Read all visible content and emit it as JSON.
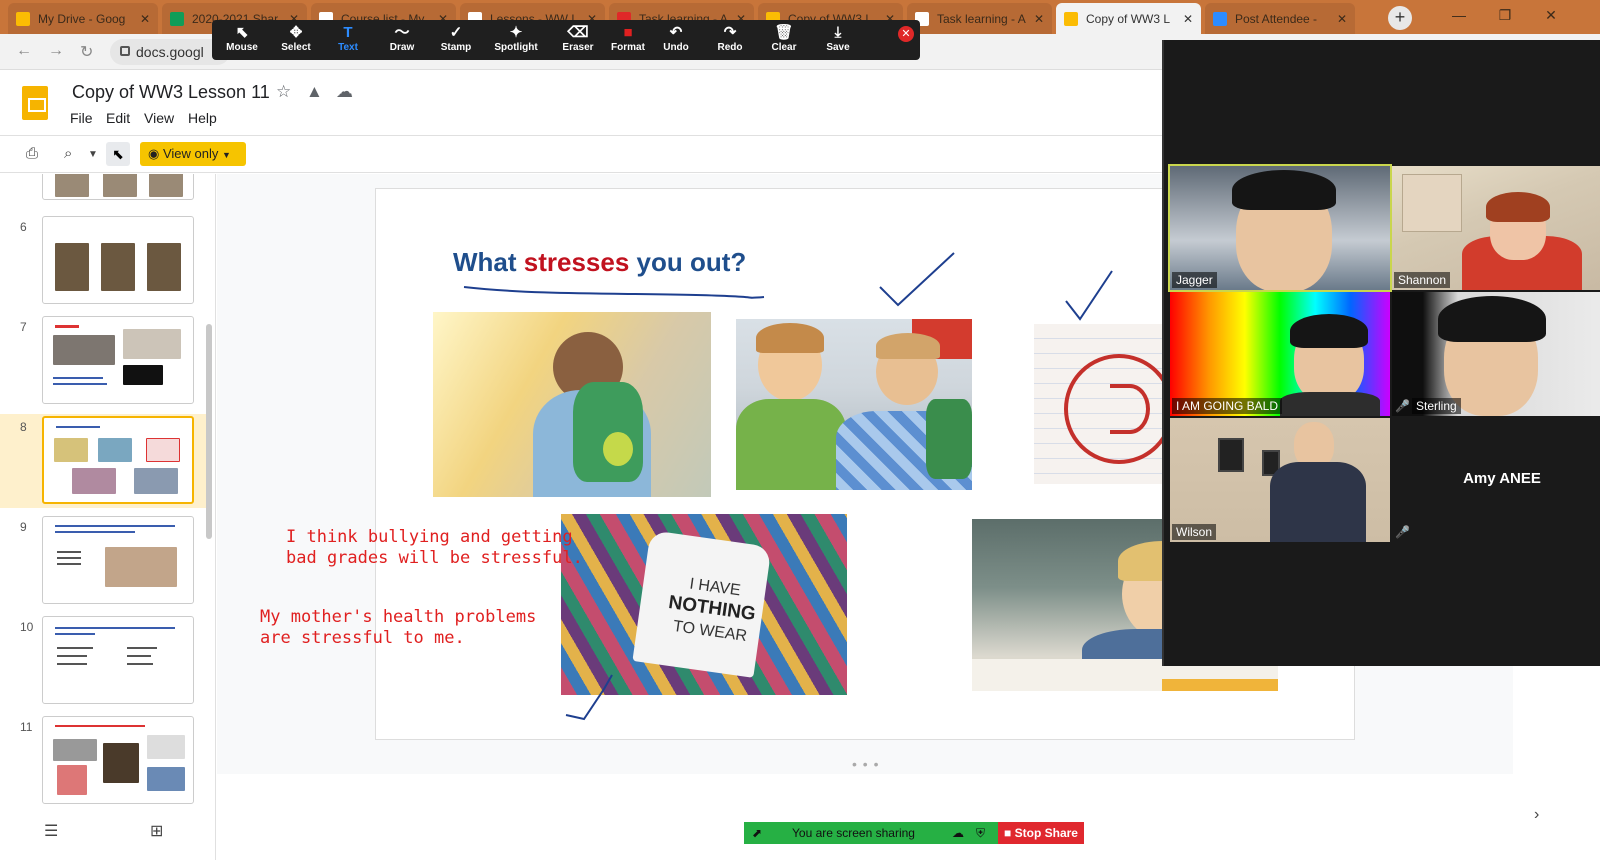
{
  "browser": {
    "tabs": [
      {
        "title": "My Drive - Goog",
        "color": "#fbbc04"
      },
      {
        "title": "2020-2021 Shar",
        "color": "#0f9d58"
      },
      {
        "title": "Course list - My",
        "color": "#ffffff"
      },
      {
        "title": "Lessons - WW L",
        "color": "#ffffff"
      },
      {
        "title": "Task learning - A",
        "color": "#e02828"
      },
      {
        "title": "Copy of WW3 L",
        "color": "#fbbc04"
      },
      {
        "title": "Task learning - A",
        "color": "#ffffff"
      },
      {
        "title": "Copy of WW3 L",
        "color": "#fbbc04",
        "active": true
      },
      {
        "title": "Post Attendee -",
        "color": "#2d8cff"
      }
    ],
    "url": "docs.googl",
    "new_tab": "+"
  },
  "annotation_toolbar": {
    "tools": [
      {
        "label": "Mouse",
        "icon": "⬉"
      },
      {
        "label": "Select",
        "icon": "✥"
      },
      {
        "label": "Text",
        "icon": "T"
      },
      {
        "label": "Draw",
        "icon": "〜"
      },
      {
        "label": "Stamp",
        "icon": "✓"
      },
      {
        "label": "Spotlight",
        "icon": "✦"
      },
      {
        "label": "Eraser",
        "icon": "⌫"
      },
      {
        "label": "Format",
        "icon": "■"
      },
      {
        "label": "Undo",
        "icon": "↶"
      },
      {
        "label": "Redo",
        "icon": "↷"
      },
      {
        "label": "Clear",
        "icon": "🗑"
      },
      {
        "label": "Save",
        "icon": "⤓"
      }
    ],
    "selected": "Text",
    "format_color": "#e02020"
  },
  "docs": {
    "title": "Copy of WW3 Lesson 11",
    "menu": [
      "File",
      "Edit",
      "View",
      "Help"
    ],
    "view_only_label": "View only",
    "brand_color": "#f6b400"
  },
  "filmstrip": {
    "slide_numbers": [
      "6",
      "7",
      "8",
      "9",
      "10",
      "11"
    ],
    "current": "8"
  },
  "slide": {
    "title_part1": "What ",
    "title_part2": "stresses",
    "title_part3": " you out?",
    "annotation_1_line1": "I think bullying and getting",
    "annotation_1_line2": "bad grades will be stressful.",
    "annotation_2_line1": "My mother's health problems",
    "annotation_2_line2": "are stressful to me.",
    "shirt_line1": "I HAVE",
    "shirt_line2": "NOTHING",
    "shirt_line3": "TO WEAR"
  },
  "zoom": {
    "participants": [
      {
        "name": "Jagger",
        "muted": false,
        "speaking": true
      },
      {
        "name": "Shannon",
        "muted": false
      },
      {
        "name": "I AM GOING BALD",
        "muted": false
      },
      {
        "name": "Sterling",
        "muted": true
      },
      {
        "name": "Wilson",
        "muted": false
      },
      {
        "name": "Amy ANEE",
        "muted": true,
        "video": false
      }
    ],
    "share_status": "You are screen sharing",
    "stop_share": "Stop Share"
  }
}
